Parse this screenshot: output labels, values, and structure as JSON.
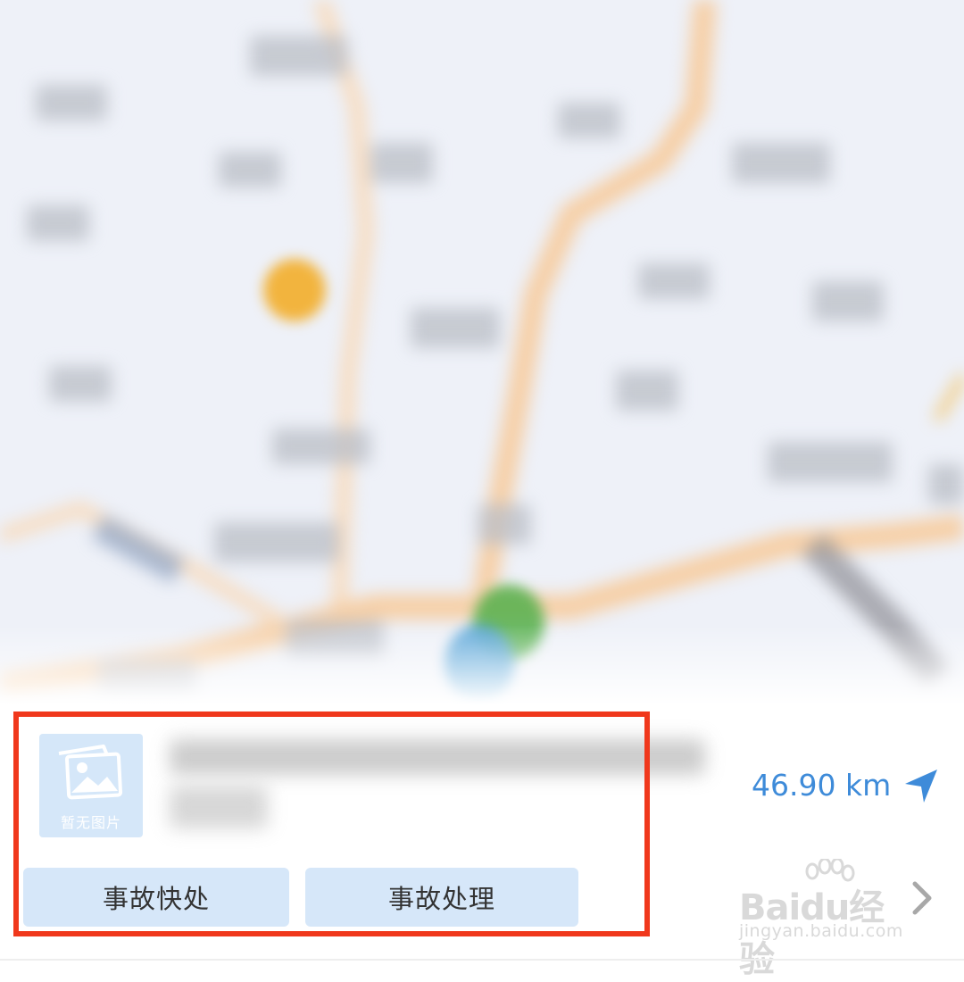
{
  "place": {
    "thumbnail_label": "暂无图片",
    "distance": "46.90 km"
  },
  "actions": {
    "quick_label": "事故快处",
    "handle_label": "事故处理"
  },
  "watermark": {
    "brand": "Baidu经验",
    "url": "jingyan.baidu.com"
  },
  "icons": {
    "thumbnail": "image-placeholder-icon",
    "navigate": "navigation-arrow-icon",
    "more": "chevron-right-icon"
  },
  "colors": {
    "accent": "#3e8bd9",
    "button_bg": "#d6e7f9",
    "highlight": "#f0381c"
  }
}
